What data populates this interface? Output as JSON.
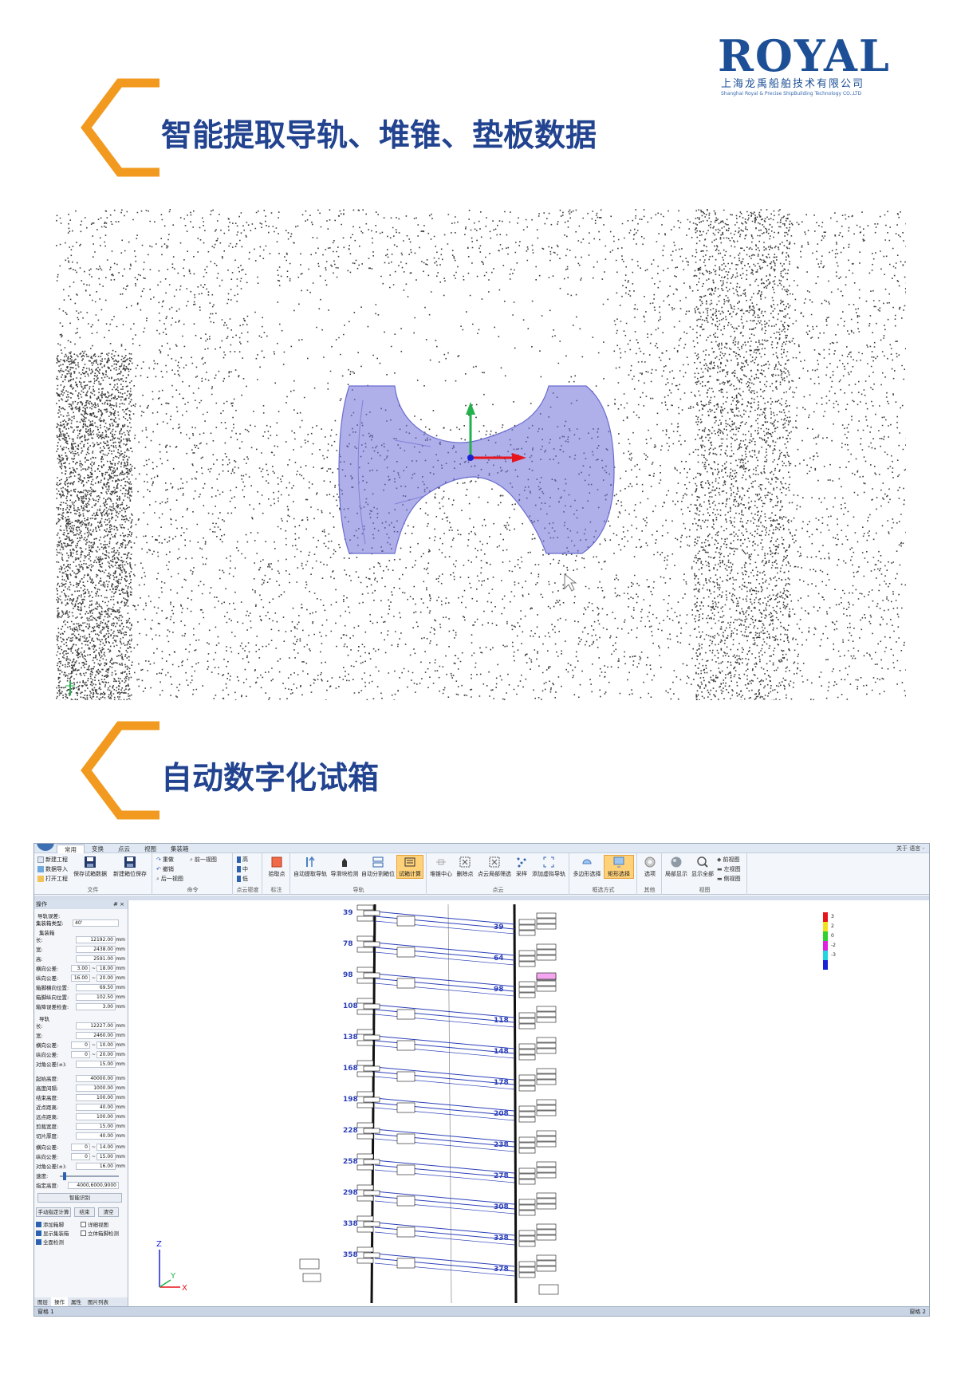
{
  "logo": {
    "wordmark": "ROYAL",
    "cn_name": "上海龙禹船舶技术有限公司",
    "en_name": "Shanghai Royal & Precise ShipBuilding Technology CO.,LTD"
  },
  "sections": [
    {
      "title": "智能提取导轨、堆锥、垫板数据"
    },
    {
      "title": "自动数字化试箱"
    }
  ],
  "colors": {
    "accent_orange": "#f19a1f",
    "title_blue": "#22438f",
    "brand_blue": "#1d4f97"
  },
  "app": {
    "tabs": [
      "常用",
      "变换",
      "点云",
      "视图",
      "集装箱"
    ],
    "active_tab": "常用",
    "help": "关于  语言 -",
    "ribbon": {
      "file": {
        "label": "文件",
        "new_project": "新建工程",
        "import_data": "数据导入",
        "open_project": "打开工程",
        "save_trial_data": "保存试箱数据",
        "new_box_save": "新建箱位保存"
      },
      "command": {
        "label": "命令",
        "redo": "重做",
        "undo": "撤销",
        "prev_view": "前一视图",
        "next_view": "后一视图"
      },
      "density": {
        "label": "点云密度",
        "high": "高",
        "mid": "中",
        "low": "低"
      },
      "mark": {
        "label": "标注",
        "pick_point": "拾取点"
      },
      "rail": {
        "label": "导轨",
        "auto_extract": "自动提取导轨",
        "guide_detect": "导滑块检测",
        "auto_split": "自动分割箱位",
        "trial_calc": "试箱计算"
      },
      "cloud": {
        "label": "点云",
        "stack_center": "堆锥中心",
        "delete_points": "删除点",
        "local_filter": "点云局部筛选",
        "sample": "采样",
        "add_virtual_rail": "添加虚拟导轨"
      },
      "select": {
        "label": "框选方式",
        "polygon": "多边形选择",
        "rect": "矩形选择"
      },
      "other": {
        "label": "其他",
        "options": "选项"
      },
      "view": {
        "label": "视图",
        "local_show": "局部显示",
        "show_all": "显示全部",
        "front": "前视图",
        "left": "左视图",
        "side": "侧视图"
      }
    },
    "panel": {
      "title": "操作",
      "pin": "# ×",
      "rail_err_label": "导轨误差:",
      "container_type_label": "集装箱类型:",
      "container_type_value": "40'",
      "container_heading": "集装箱",
      "rail_heading": "导轨",
      "rows1": [
        {
          "label": "长:",
          "value": "12192.00",
          "unit": "mm"
        },
        {
          "label": "宽:",
          "value": "2438.00",
          "unit": "mm"
        },
        {
          "label": "高:",
          "value": "2591.00",
          "unit": "mm"
        }
      ],
      "tol_rows1": [
        {
          "label": "横向公差:",
          "a": "3.00",
          "b": "18.00",
          "unit": "mm"
        },
        {
          "label": "纵向公差:",
          "a": "16.00",
          "b": "20.00",
          "unit": "mm"
        }
      ],
      "rows2": [
        {
          "label": "箱脚横向位置:",
          "value": "69.50",
          "unit": "mm"
        },
        {
          "label": "箱脚纵向位置:",
          "value": "102.50",
          "unit": "mm"
        },
        {
          "label": "箱降误差检查:",
          "value": "3.00",
          "unit": "mm"
        }
      ],
      "rows3": [
        {
          "label": "长:",
          "value": "12227.00",
          "unit": "mm"
        },
        {
          "label": "宽:",
          "value": "2460.00",
          "unit": "mm"
        }
      ],
      "tol_rows2": [
        {
          "label": "横向公差:",
          "a": "0",
          "b": "10.00",
          "unit": "mm"
        },
        {
          "label": "纵向公差:",
          "a": "0",
          "b": "20.00",
          "unit": "mm"
        }
      ],
      "diag1": {
        "label": "对角公差(±):",
        "value": "15.00",
        "unit": "mm"
      },
      "rows4": [
        {
          "label": "起始高度:",
          "value": "40000.00",
          "unit": "mm"
        },
        {
          "label": "高度间隔:",
          "value": "1000.00",
          "unit": "mm"
        },
        {
          "label": "结束高度:",
          "value": "100.00",
          "unit": "mm"
        },
        {
          "label": "近点距离:",
          "value": "40.00",
          "unit": "mm"
        },
        {
          "label": "远点距离:",
          "value": "100.00",
          "unit": "mm"
        },
        {
          "label": "剪裁宽度:",
          "value": "15.00",
          "unit": "mm"
        },
        {
          "label": "切片厚度:",
          "value": "40.00",
          "unit": "mm"
        }
      ],
      "tol_rows3": [
        {
          "label": "横向公差:",
          "a": "0",
          "b": "14.00",
          "unit": "mm"
        },
        {
          "label": "纵向公差:",
          "a": "0",
          "b": "15.00",
          "unit": "mm"
        }
      ],
      "diag2": {
        "label": "对角公差(±):",
        "value": "16.00",
        "unit": "mm"
      },
      "speed_label": "速度:",
      "height_label": "指定高度:",
      "height_value": "4000,6000,9000",
      "smart_btn": "智能识别",
      "manual_btn": "手动指定计算",
      "end_btn": "结束",
      "clear_btn": "清空",
      "checks": [
        {
          "label": "添加箱脚",
          "on": true
        },
        {
          "label": "详细视图",
          "on": false
        },
        {
          "label": "显示集装箱",
          "on": true
        },
        {
          "label": "立体箱脚检测",
          "on": false
        },
        {
          "label": "全面检测",
          "on": true
        }
      ],
      "footer_tabs": [
        "图层",
        "操作",
        "属性",
        "图片列表"
      ]
    },
    "viewport": {
      "axis_z": "Z",
      "axis_y": "Y",
      "axis_x": "X",
      "left_labels": [
        "39",
        "78",
        "98",
        "108",
        "138",
        "168",
        "198",
        "228",
        "258",
        "298",
        "338",
        "358"
      ],
      "right_labels": [
        "39",
        "64",
        "98",
        "118",
        "148",
        "178",
        "208",
        "238",
        "278",
        "308",
        "338",
        "378"
      ],
      "legend": [
        {
          "value": "3",
          "color": "#e8141b"
        },
        {
          "value": "2",
          "color": "#f0e020"
        },
        {
          "value": "0",
          "color": "#2ed12e"
        },
        {
          "value": "-2",
          "color": "#e020e0"
        },
        {
          "value": "-3",
          "color": "#20d4e0"
        },
        {
          "value": "",
          "color": "#1a22d4"
        }
      ]
    },
    "status_left": "窗格 1",
    "status_right": "窗格 2"
  }
}
